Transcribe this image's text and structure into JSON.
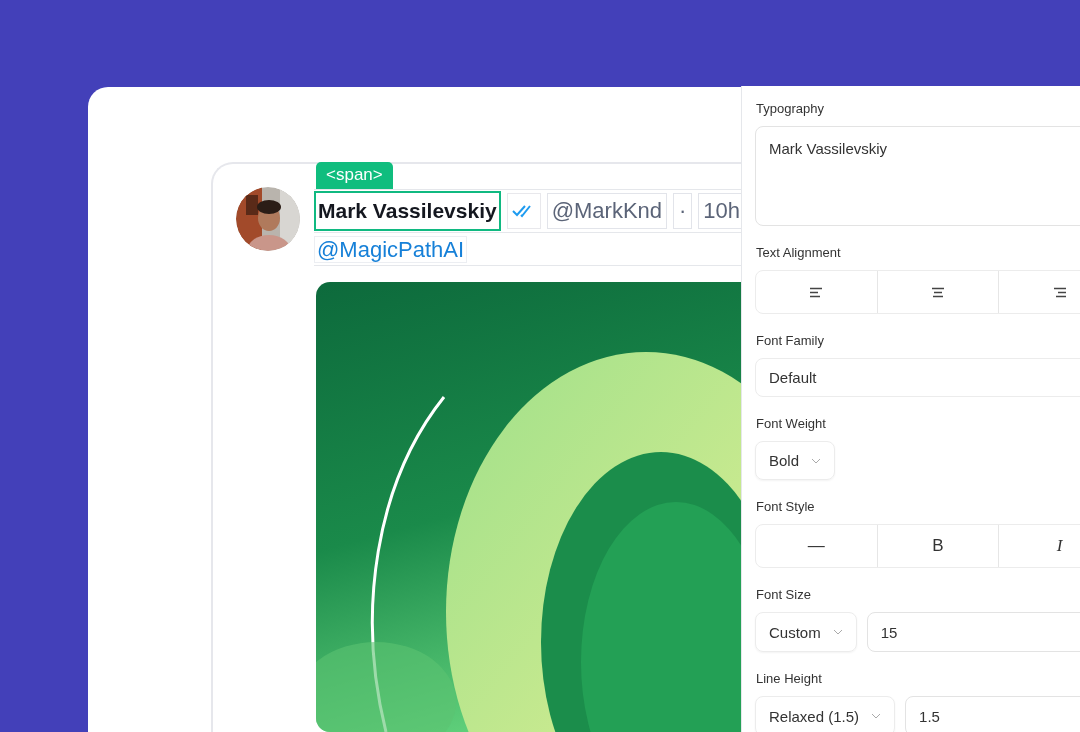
{
  "tweet": {
    "element_tag": "<span>",
    "author": {
      "name": "Mark Vassilevskiy",
      "verified": true,
      "handle": "@MarkKnd",
      "separator": "·",
      "time": "10h"
    },
    "mention": "@MagicPathAI"
  },
  "panel": {
    "sections": [
      {
        "kind": "textarea",
        "label": "Typography",
        "value": "Mark Vassilevskiy"
      },
      {
        "kind": "align",
        "label": "Text Alignment"
      },
      {
        "kind": "select",
        "label": "Font Family",
        "value": "Default",
        "chevron": false
      },
      {
        "kind": "select",
        "label": "Font Weight",
        "value": "Bold",
        "chevron": true
      },
      {
        "kind": "style",
        "label": "Font Style",
        "options": [
          {
            "label": "—",
            "italic": false
          },
          {
            "label": "B",
            "italic": false
          },
          {
            "label": "I",
            "italic": true
          }
        ]
      },
      {
        "kind": "combo",
        "label": "Font Size",
        "value": "Custom",
        "input": "15"
      },
      {
        "kind": "combo",
        "label": "Line Height",
        "value": "Relaxed (1.5)",
        "input": "1.5"
      }
    ]
  }
}
